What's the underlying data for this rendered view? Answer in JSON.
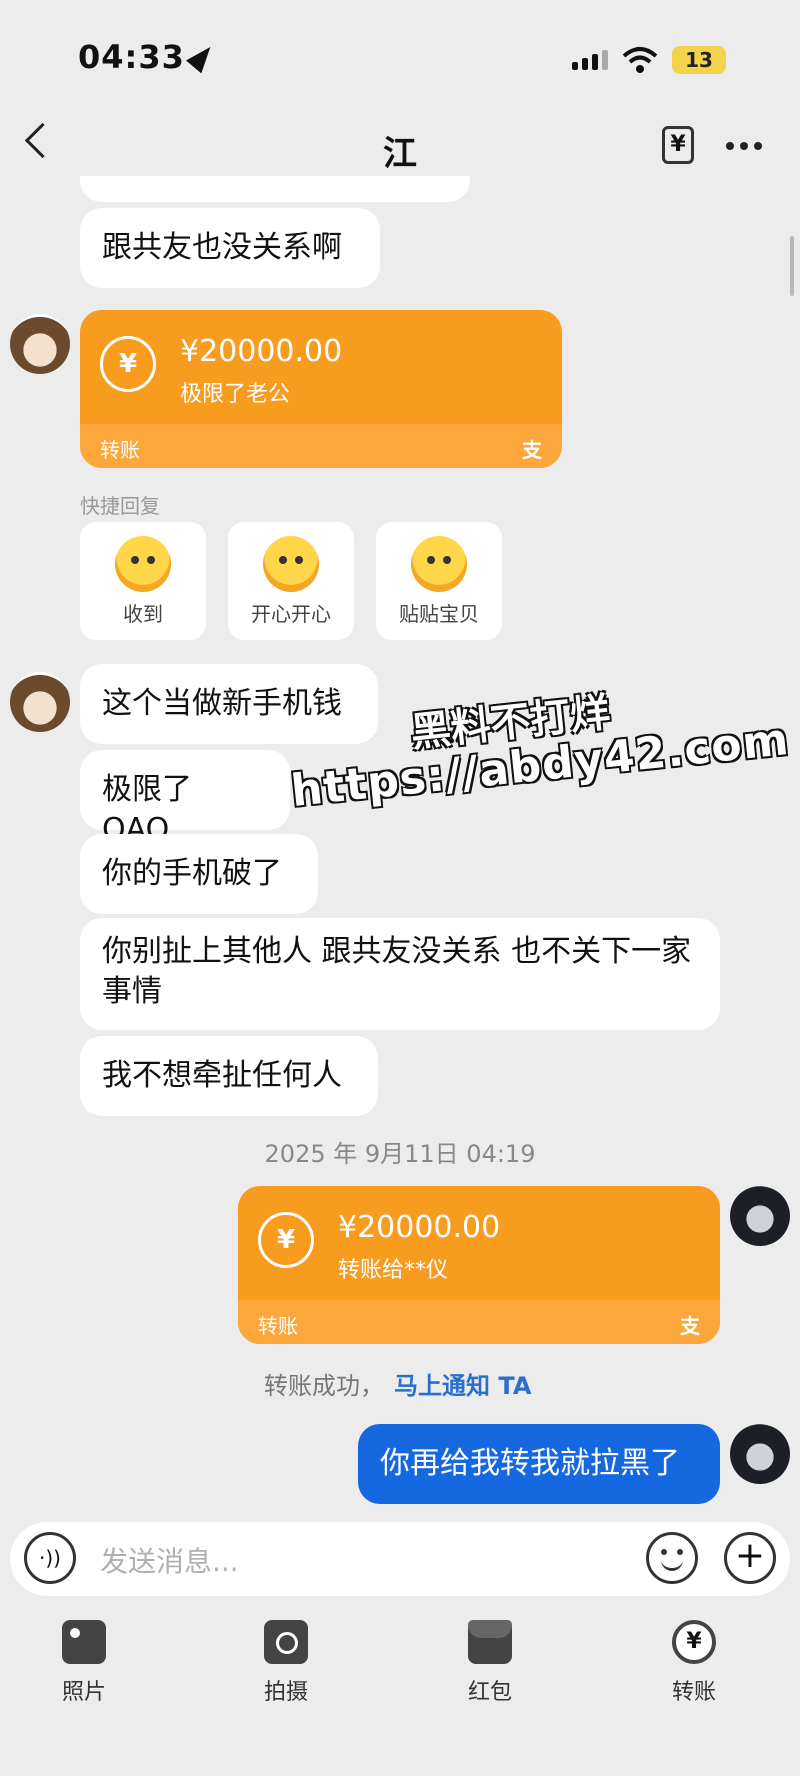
{
  "status_bar": {
    "time": "04:33",
    "battery": "13"
  },
  "header": {
    "title": "江",
    "yen_icon": "¥"
  },
  "messages": {
    "m0": "跟共友也没关系啊",
    "m1": "这个当做新手机钱",
    "m2": "极限了 QAQ",
    "m3": "你的手机破了",
    "m4": "你别扯上其他人 跟共友没关系 也不关下一家事情",
    "m5": "我不想牵扯任何人",
    "mine1": "你再给我转我就拉黑了"
  },
  "transfer_received": {
    "amount": "¥20000.00",
    "note": "极限了老公",
    "label": "转账",
    "alipay": "支",
    "coin": "¥"
  },
  "transfer_sent": {
    "amount": "¥20000.00",
    "note": "转账给**仪",
    "label": "转账",
    "alipay": "支",
    "coin": "¥"
  },
  "quick_reply": {
    "label": "快捷回复",
    "items": [
      "收到",
      "开心开心",
      "贴贴宝贝"
    ]
  },
  "timestamp": "2025 年 9月11日 04:19",
  "transfer_status": {
    "text": "转账成功，",
    "link": "马上通知 TA"
  },
  "watermark": {
    "line1": "黑料不打烊",
    "line2": "https://abdy42.com"
  },
  "input": {
    "placeholder": "发送消息..."
  },
  "actions": [
    "照片",
    "拍摄",
    "红包",
    "转账"
  ],
  "colors": {
    "accent_orange": "#f79c1f",
    "my_bubble": "#1668e0",
    "link_blue": "#2a6fcf"
  }
}
